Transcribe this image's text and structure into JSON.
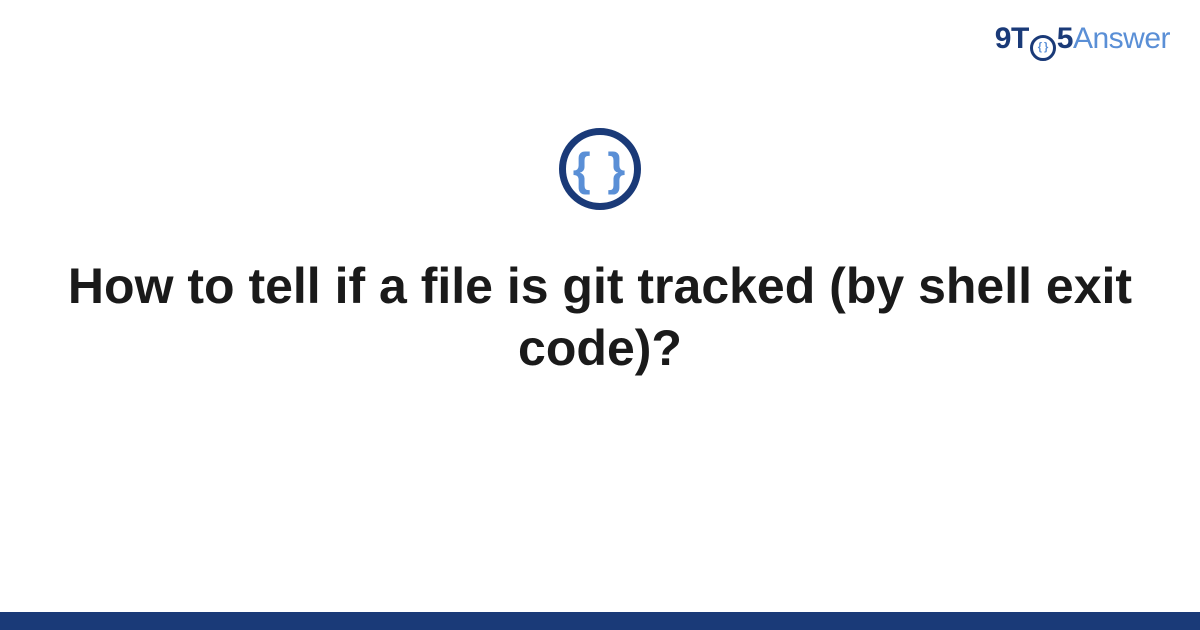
{
  "brand": {
    "part1": "9",
    "part2": "T",
    "o_inner": "{ }",
    "part3": "5",
    "part4": "Answer"
  },
  "icon": {
    "braces": "{ }"
  },
  "title": "How to tell if a file is git tracked (by shell exit code)?"
}
